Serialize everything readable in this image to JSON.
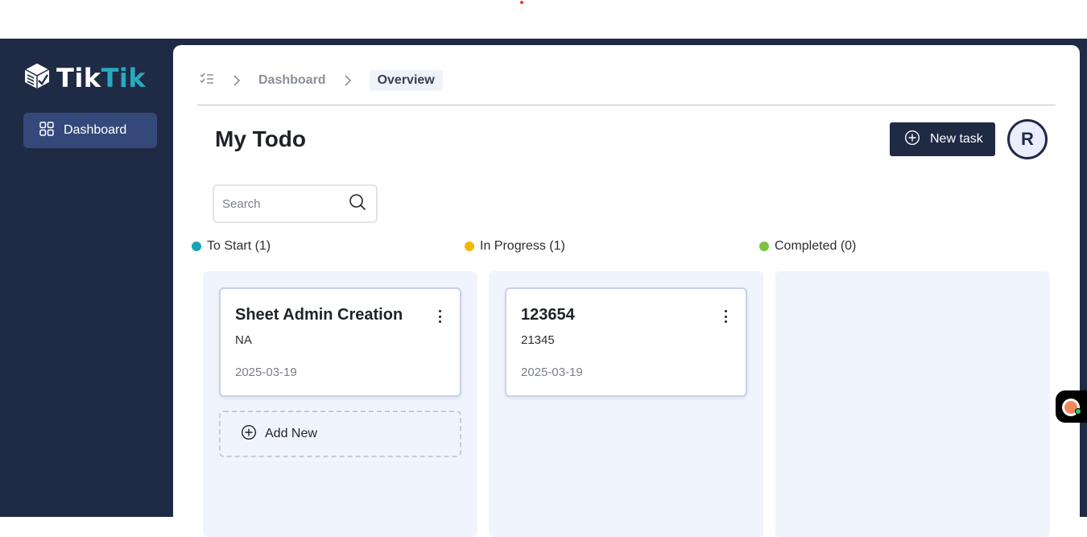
{
  "app": {
    "logo_part1": "Tik",
    "logo_part2": "Tik"
  },
  "sidebar": {
    "items": [
      {
        "label": "Dashboard",
        "icon": "grid-icon",
        "active": true
      }
    ]
  },
  "breadcrumb": {
    "icon": "checklist-icon",
    "items": [
      "Dashboard",
      "Overview"
    ]
  },
  "header": {
    "title": "My Todo",
    "new_task_label": "New task",
    "avatar_initial": "R"
  },
  "search": {
    "placeholder": "Search"
  },
  "columns": [
    {
      "label": "To Start (1)",
      "color": "#1ba3b5",
      "cards": [
        {
          "title": "Sheet Admin Creation",
          "description": "NA",
          "date": "2025-03-19"
        }
      ],
      "add_label": "Add New"
    },
    {
      "label": "In Progress (1)",
      "color": "#f5b800",
      "cards": [
        {
          "title": "123654",
          "description": "21345",
          "date": "2025-03-19"
        }
      ]
    },
    {
      "label": "Completed (0)",
      "color": "#7cc242",
      "cards": []
    }
  ],
  "colors": {
    "sidebar_bg": "#1f2a44",
    "active_nav": "#34497a",
    "accent": "#29a9c0",
    "column_bg": "#f0f5fd"
  }
}
